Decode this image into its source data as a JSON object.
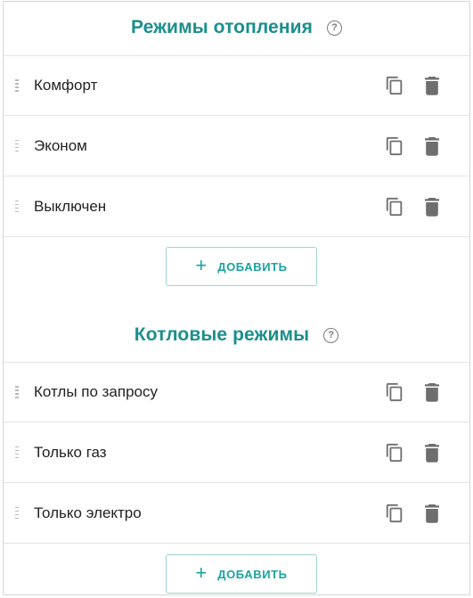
{
  "heating_modes": {
    "title": "Режимы отопления",
    "help_icon": "?",
    "items": [
      {
        "label": "Комфорт"
      },
      {
        "label": "Эконом"
      },
      {
        "label": "Выключен"
      }
    ],
    "add_button": {
      "plus": "+",
      "label": "ДОБАВИТЬ"
    }
  },
  "boiler_modes": {
    "title": "Котловые режимы",
    "help_icon": "?",
    "items": [
      {
        "label": "Котлы по запросу"
      },
      {
        "label": "Только газ"
      },
      {
        "label": "Только электро"
      }
    ],
    "add_button": {
      "plus": "+",
      "label": "ДОБАВИТЬ"
    }
  },
  "icons": {
    "drag": "drag-handle-icon",
    "copy": "copy-icon",
    "delete": "trash-icon",
    "help": "help-circle-icon"
  },
  "colors": {
    "accent": "#1a8f8c",
    "button_text": "#1aa39f",
    "button_border": "#9fd3d1",
    "icon_gray": "#6e6e6e"
  }
}
